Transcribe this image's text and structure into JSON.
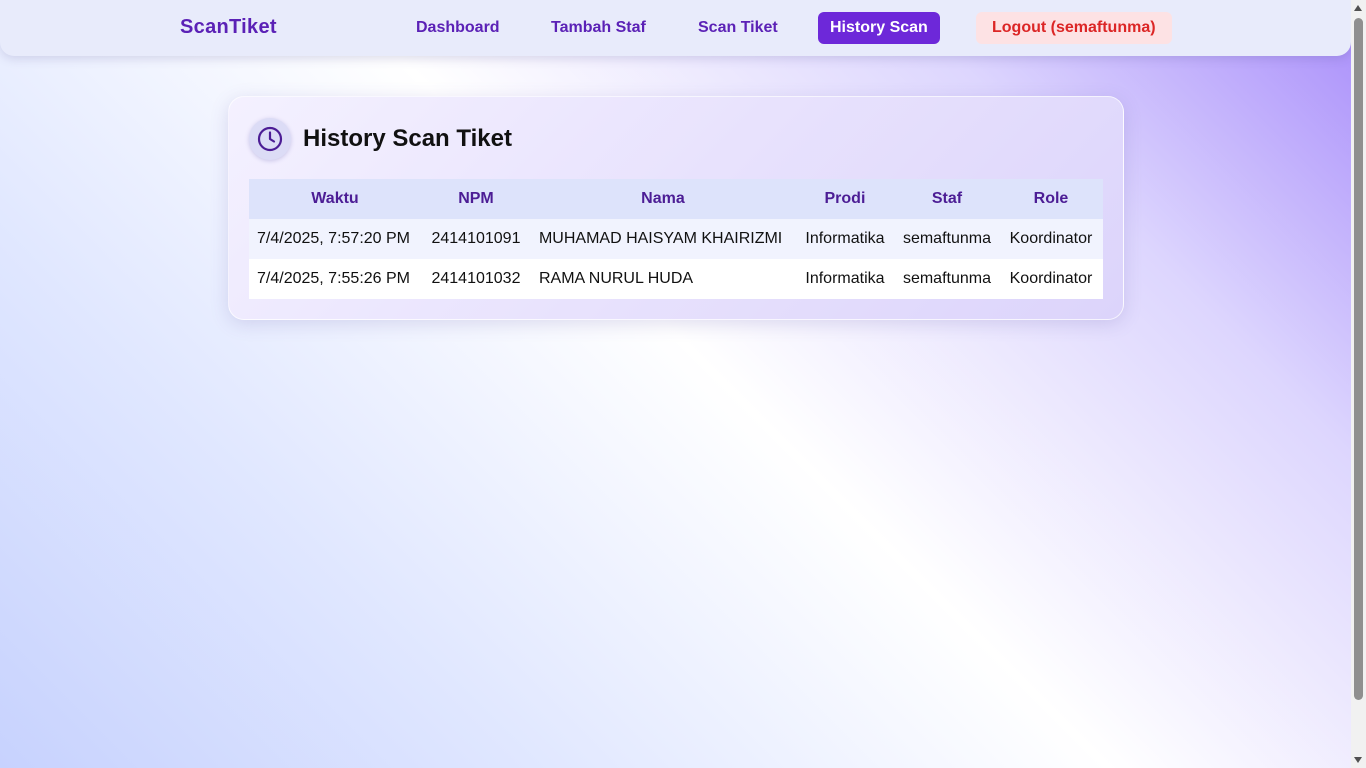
{
  "navbar": {
    "brand": "ScanTiket",
    "links": [
      {
        "label": "Dashboard"
      },
      {
        "label": "Tambah Staf"
      },
      {
        "label": "Scan Tiket"
      },
      {
        "label": "History Scan",
        "active": true
      }
    ],
    "logout_label": "Logout (semaftunma)"
  },
  "history": {
    "icon": "clock-icon",
    "title": "History Scan Tiket",
    "columns": [
      "Waktu",
      "NPM",
      "Nama",
      "Prodi",
      "Staf",
      "Role"
    ],
    "rows": [
      [
        "7/4/2025, 7:57:20 PM",
        "2414101091",
        "MUHAMAD HAISYAM KHAIRIZMI",
        "Informatika",
        "semaftunma",
        "Koordinator"
      ],
      [
        "7/4/2025, 7:55:26 PM",
        "2414101032",
        "RAMA NURUL HUDA",
        "Informatika",
        "semaftunma",
        "Koordinator"
      ]
    ]
  },
  "colors": {
    "accent": "#6d28d9",
    "brand": "#5b21b6",
    "logout_text": "#dc2626",
    "logout_bg": "#fde2e4"
  }
}
